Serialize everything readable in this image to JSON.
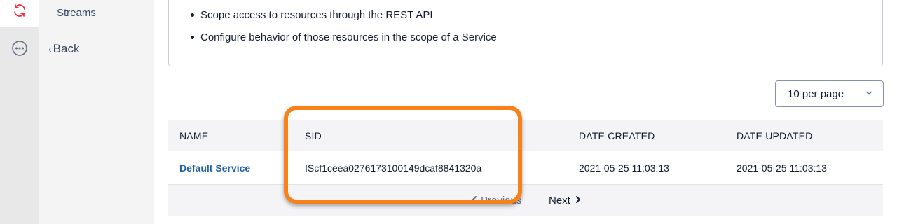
{
  "nav": {
    "item": "Streams",
    "back_label": "Back"
  },
  "description": {
    "bullets": [
      "Scope access to resources through the REST API",
      "Configure behavior of those resources in the scope of a Service"
    ]
  },
  "pagination": {
    "per_page": "10 per page",
    "prev_label": "Previous",
    "next_label": "Next"
  },
  "table": {
    "headers": [
      "NAME",
      "SID",
      "DATE CREATED",
      "DATE UPDATED"
    ],
    "rows": [
      {
        "name": "Default Service",
        "sid": "IScf1ceea0276173100149dcaf8841320a",
        "date_created": "2021-05-25 11:03:13",
        "date_updated": "2021-05-25 11:03:13"
      }
    ]
  },
  "colors": {
    "accent": "#f22f46",
    "link": "#1f5fa8",
    "highlight": "#f7821b"
  },
  "icons": {
    "rail_top": "sync-icon",
    "rail_more": "more-horizontal-icon",
    "select": "chevron-down-icon",
    "next": "chevron-right-icon",
    "prev": "chevron-left-icon"
  }
}
